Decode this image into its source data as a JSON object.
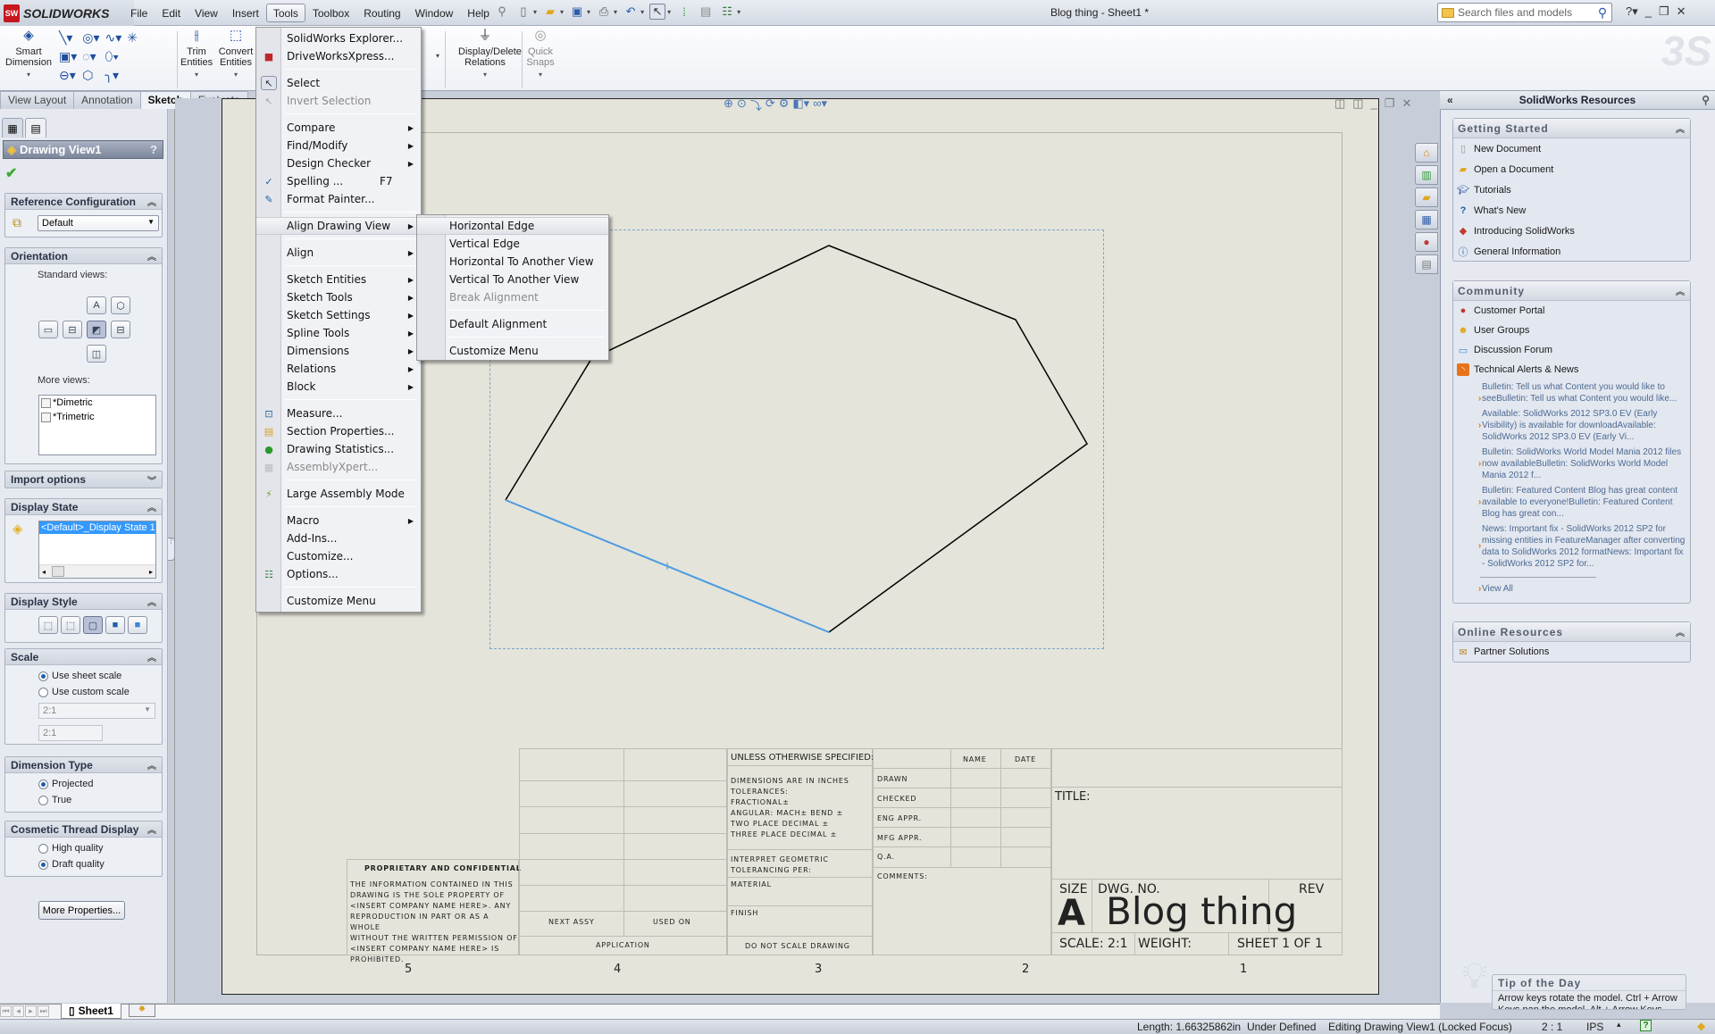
{
  "app": {
    "name": "SOLIDWORKS",
    "logo_badge": "SW",
    "document_title": "Blog thing - Sheet1 *"
  },
  "menubar": [
    "File",
    "Edit",
    "View",
    "Insert",
    "Tools",
    "Toolbox",
    "Routing",
    "Window",
    "Help"
  ],
  "search": {
    "placeholder": "Search files and models"
  },
  "commands": {
    "smart_dimension": "Smart Dimension",
    "trim_entities": "Trim Entities",
    "convert_entities": "Convert Entities",
    "display_delete_relations": "Display/Delete Relations",
    "quick_snaps": "Quick Snaps"
  },
  "command_tabs": [
    "View Layout",
    "Annotation",
    "Sketch",
    "Evaluate"
  ],
  "active_command_tab": "Sketch",
  "property_manager": {
    "title": "Drawing View1",
    "help": "?",
    "reference_configuration": {
      "header": "Reference Configuration",
      "value": "Default"
    },
    "orientation": {
      "header": "Orientation",
      "standard_views_label": "Standard views:",
      "more_views_label": "More views:",
      "more_views": [
        "*Dimetric",
        "*Trimetric"
      ]
    },
    "import_options": {
      "header": "Import options"
    },
    "display_state": {
      "header": "Display State",
      "selected": "<Default>_Display State 1"
    },
    "display_style": {
      "header": "Display Style"
    },
    "scale": {
      "header": "Scale",
      "options": [
        "Use sheet scale",
        "Use custom scale"
      ],
      "selected": "Use sheet scale",
      "dropdown_value": "2:1",
      "custom_value": "2:1"
    },
    "dimension_type": {
      "header": "Dimension Type",
      "options": [
        "Projected",
        "True"
      ],
      "selected": "Projected"
    },
    "cosmetic_thread": {
      "header": "Cosmetic Thread Display",
      "options": [
        "High quality",
        "Draft quality"
      ],
      "selected": "Draft quality"
    },
    "more_properties": "More Properties..."
  },
  "tools_menu": {
    "items": [
      {
        "label": "SolidWorks Explorer...",
        "icon": "explorer-icon"
      },
      {
        "label": "DriveWorksXpress...",
        "icon": "driveworks-icon"
      },
      {
        "sep": true
      },
      {
        "label": "Select",
        "icon": "select-arrow-icon"
      },
      {
        "label": "Invert Selection",
        "icon": "invert-selection-icon",
        "disabled": true
      },
      {
        "sep": true
      },
      {
        "label": "Compare",
        "submenu": true
      },
      {
        "label": "Find/Modify",
        "submenu": true
      },
      {
        "label": "Design Checker",
        "submenu": true
      },
      {
        "label": "Spelling ...",
        "shortcut": "F7",
        "icon": "spelling-icon"
      },
      {
        "label": "Format Painter...",
        "icon": "format-painter-icon"
      },
      {
        "sep": true
      },
      {
        "label": "Align Drawing View",
        "submenu": true,
        "highlighted": true
      },
      {
        "sep": true
      },
      {
        "label": "Align",
        "submenu": true
      },
      {
        "sep": true
      },
      {
        "label": "Sketch Entities",
        "submenu": true
      },
      {
        "label": "Sketch Tools",
        "submenu": true
      },
      {
        "label": "Sketch Settings",
        "submenu": true
      },
      {
        "label": "Spline Tools",
        "submenu": true
      },
      {
        "label": "Dimensions",
        "submenu": true
      },
      {
        "label": "Relations",
        "submenu": true
      },
      {
        "label": "Block",
        "submenu": true
      },
      {
        "sep": true
      },
      {
        "label": "Measure...",
        "icon": "measure-icon"
      },
      {
        "label": "Section Properties...",
        "icon": "section-properties-icon"
      },
      {
        "label": "Drawing Statistics...",
        "icon": "drawing-statistics-icon"
      },
      {
        "label": "AssemblyXpert...",
        "icon": "assemblyxpert-icon",
        "disabled": true
      },
      {
        "sep": true
      },
      {
        "label": "Large Assembly Mode",
        "icon": "large-assembly-icon"
      },
      {
        "sep": true
      },
      {
        "label": "Macro",
        "submenu": true
      },
      {
        "label": "Add-Ins..."
      },
      {
        "label": "Customize..."
      },
      {
        "label": "Options...",
        "icon": "options-icon"
      },
      {
        "sep": true
      },
      {
        "label": "Customize Menu"
      }
    ]
  },
  "align_submenu": {
    "items": [
      {
        "label": "Horizontal Edge",
        "highlighted": true
      },
      {
        "label": "Vertical Edge"
      },
      {
        "label": "Horizontal To Another View"
      },
      {
        "label": "Vertical To Another View"
      },
      {
        "label": "Break Alignment",
        "disabled": true
      },
      {
        "sep": true
      },
      {
        "label": "Default Alignment"
      },
      {
        "sep": true
      },
      {
        "label": "Customize Menu"
      }
    ]
  },
  "title_block": {
    "unless": "UNLESS OTHERWISE SPECIFIED:",
    "name": "NAME",
    "date": "DATE",
    "rows": [
      "DRAWN",
      "CHECKED",
      "ENG APPR.",
      "MFG APPR.",
      "Q.A.",
      "COMMENTS:"
    ],
    "tolerances": [
      "DIMENSIONS ARE IN INCHES",
      "TOLERANCES:",
      "FRACTIONAL±",
      "ANGULAR: MACH±    BEND ±",
      "TWO PLACE DECIMAL    ±",
      "THREE PLACE DECIMAL  ±"
    ],
    "interpret": [
      "INTERPRET GEOMETRIC",
      "TOLERANCING PER:"
    ],
    "material": "MATERIAL",
    "finish": "FINISH",
    "do_not_scale": "DO NOT SCALE DRAWING",
    "next_assy": "NEXT ASSY",
    "used_on": "USED ON",
    "application": "APPLICATION",
    "proprietary_title": "PROPRIETARY AND CONFIDENTIAL",
    "proprietary_text": [
      "THE INFORMATION CONTAINED IN THIS",
      "DRAWING IS THE SOLE PROPERTY OF",
      "<INSERT COMPANY NAME HERE>.  ANY",
      "REPRODUCTION IN PART OR AS A WHOLE",
      "WITHOUT THE WRITTEN PERMISSION OF",
      "<INSERT COMPANY NAME HERE> IS",
      "PROHIBITED."
    ],
    "title_label": "TITLE:",
    "size_label": "SIZE",
    "size": "A",
    "dwg_no_label": "DWG.  NO.",
    "dwg_no": "Blog thing",
    "rev_label": "REV",
    "scale": "SCALE: 2:1",
    "weight": "WEIGHT:",
    "sheet": "SHEET 1 OF 1",
    "zones": [
      "5",
      "4",
      "3",
      "2",
      "1"
    ]
  },
  "task_pane": {
    "title": "SolidWorks Resources",
    "getting_started": {
      "header": "Getting Started",
      "items": [
        {
          "label": "New Document",
          "icon": "new-document-icon"
        },
        {
          "label": "Open a Document",
          "icon": "open-document-icon"
        },
        {
          "label": "Tutorials",
          "icon": "tutorials-icon"
        },
        {
          "label": "What's New",
          "icon": "whats-new-icon"
        },
        {
          "label": "Introducing SolidWorks",
          "icon": "introducing-icon"
        },
        {
          "label": "General Information",
          "icon": "info-icon"
        }
      ]
    },
    "community": {
      "header": "Community",
      "items": [
        {
          "label": "Customer Portal",
          "icon": "customer-portal-icon"
        },
        {
          "label": "User Groups",
          "icon": "user-groups-icon"
        },
        {
          "label": "Discussion Forum",
          "icon": "discussion-forum-icon"
        },
        {
          "label": "Technical Alerts & News",
          "icon": "rss-icon"
        }
      ],
      "news": [
        "Bulletin: Tell us what Content you would like to seeBulletin: Tell us what Content you would like...",
        "Available: SolidWorks 2012 SP3.0 EV (Early Visibility) is available for downloadAvailable: SolidWorks 2012 SP3.0 EV (Early Vi...",
        "Bulletin: SolidWorks World Model Mania 2012 files now availableBulletin: SolidWorks World Model Mania 2012 f...",
        "Bulletin: Featured Content Blog has great content available to everyone!Bulletin: Featured Content Blog has great con...",
        "News: Important fix - SolidWorks 2012 SP2 for missing entities in FeatureManager after converting data to SolidWorks 2012 formatNews: Important fix - SolidWorks 2012 SP2 for..."
      ],
      "view_all": "View All"
    },
    "online_resources": {
      "header": "Online Resources",
      "items": [
        {
          "label": "Partner Solutions",
          "icon": "partner-solutions-icon"
        }
      ]
    },
    "tip": {
      "title": "Tip of the Day",
      "text": "Arrow keys rotate the model. Ctrl + Arrow Keys pan the model. Alt + Arrow Keys"
    }
  },
  "sheet_tabs": {
    "active": "Sheet1"
  },
  "status_bar": {
    "length": "Length: 1.66325862in",
    "definition": "Under Defined",
    "mode": "Editing Drawing View1 (Locked Focus)",
    "scale": "2 : 1",
    "units": "IPS"
  },
  "colors": {
    "selected_edge": "#4d9be0",
    "sketch_line": "#000000",
    "sheet_bg": "#e4e4da",
    "view_boundary": "#7ca4c9"
  }
}
